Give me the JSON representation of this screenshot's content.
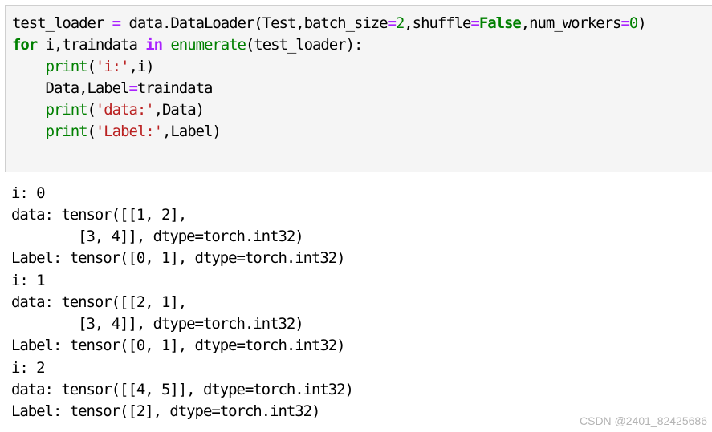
{
  "colors": {
    "keyword": "#008000",
    "builtin": "#008000",
    "operator": "#aa22ff",
    "string": "#ba2121",
    "number": "#008000",
    "input_bg": "#f5f5f5",
    "border": "#cfcfcf",
    "watermark": "#b4b4b4"
  },
  "input_cell": {
    "lines": [
      [
        {
          "t": "test_loader "
        },
        {
          "t": "=",
          "k": "op"
        },
        {
          "t": " data.DataLoader(Test,batch_size"
        },
        {
          "t": "=",
          "k": "op"
        },
        {
          "t": "2",
          "k": "num"
        },
        {
          "t": ",shuffle"
        },
        {
          "t": "=",
          "k": "op"
        },
        {
          "t": "False",
          "k": "kw"
        },
        {
          "t": ",num_workers"
        },
        {
          "t": "=",
          "k": "op"
        },
        {
          "t": "0",
          "k": "num"
        },
        {
          "t": ")"
        }
      ],
      [
        {
          "t": "for",
          "k": "kw"
        },
        {
          "t": " i,traindata "
        },
        {
          "t": "in",
          "k": "op"
        },
        {
          "t": " "
        },
        {
          "t": "enumerate",
          "k": "fn"
        },
        {
          "t": "(test_loader):"
        }
      ],
      [
        {
          "t": "    "
        },
        {
          "t": "print",
          "k": "fn"
        },
        {
          "t": "("
        },
        {
          "t": "'i:'",
          "k": "str"
        },
        {
          "t": ",i)"
        }
      ],
      [
        {
          "t": "    Data,Label"
        },
        {
          "t": "=",
          "k": "op"
        },
        {
          "t": "traindata"
        }
      ],
      [
        {
          "t": "    "
        },
        {
          "t": "print",
          "k": "fn"
        },
        {
          "t": "("
        },
        {
          "t": "'data:'",
          "k": "str"
        },
        {
          "t": ",Data)"
        }
      ],
      [
        {
          "t": "    "
        },
        {
          "t": "print",
          "k": "fn"
        },
        {
          "t": "("
        },
        {
          "t": "'Label:'",
          "k": "str"
        },
        {
          "t": ",Label)"
        }
      ]
    ]
  },
  "output": {
    "lines": [
      "i: 0",
      "data: tensor([[1, 2],",
      "        [3, 4]], dtype=torch.int32)",
      "Label: tensor([0, 1], dtype=torch.int32)",
      "i: 1",
      "data: tensor([[2, 1],",
      "        [3, 4]], dtype=torch.int32)",
      "Label: tensor([0, 1], dtype=torch.int32)",
      "i: 2",
      "data: tensor([[4, 5]], dtype=torch.int32)",
      "Label: tensor([2], dtype=torch.int32)"
    ]
  },
  "watermark": "CSDN @2401_82425686"
}
